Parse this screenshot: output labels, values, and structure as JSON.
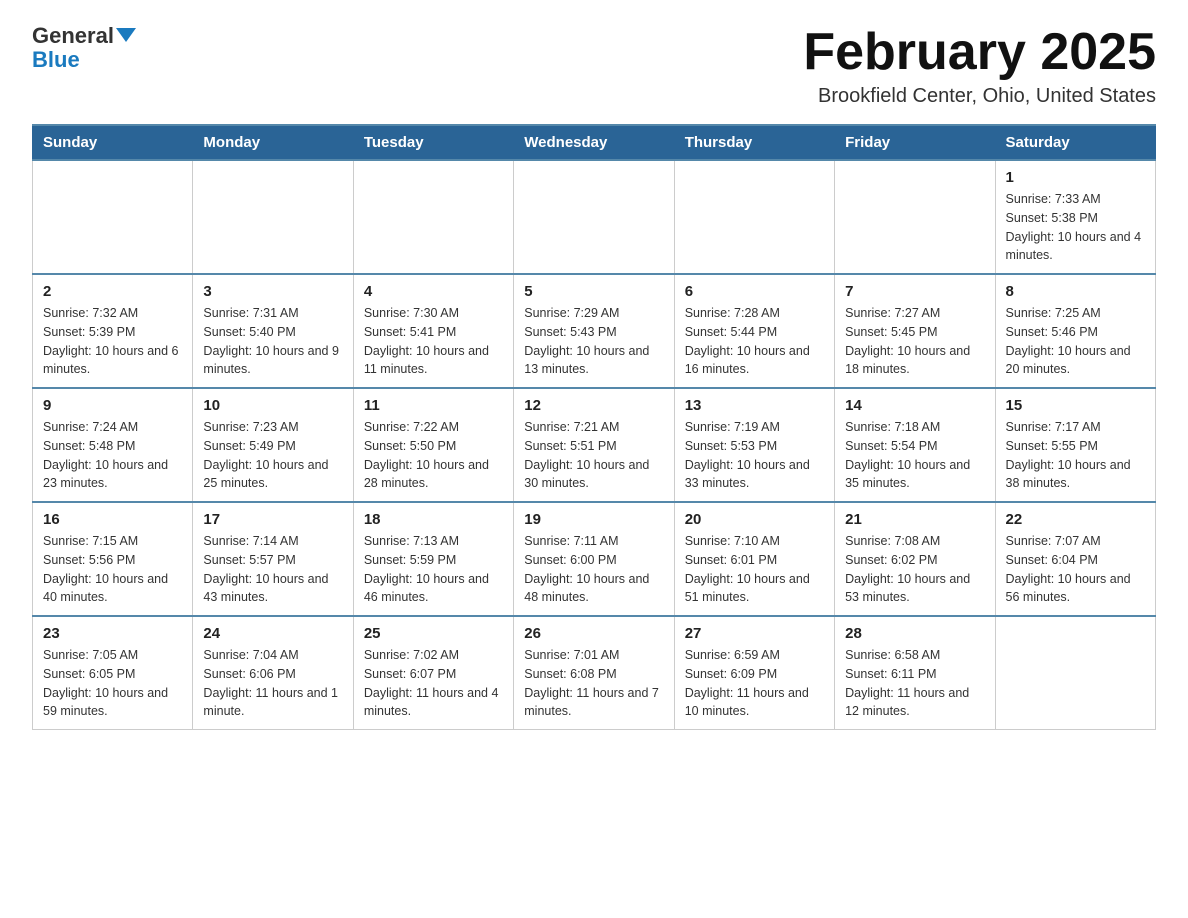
{
  "header": {
    "logo_line1": "General",
    "logo_line2": "Blue",
    "month_title": "February 2025",
    "location": "Brookfield Center, Ohio, United States"
  },
  "days_of_week": [
    "Sunday",
    "Monday",
    "Tuesday",
    "Wednesday",
    "Thursday",
    "Friday",
    "Saturday"
  ],
  "weeks": [
    [
      {
        "day": "",
        "info": ""
      },
      {
        "day": "",
        "info": ""
      },
      {
        "day": "",
        "info": ""
      },
      {
        "day": "",
        "info": ""
      },
      {
        "day": "",
        "info": ""
      },
      {
        "day": "",
        "info": ""
      },
      {
        "day": "1",
        "info": "Sunrise: 7:33 AM\nSunset: 5:38 PM\nDaylight: 10 hours and 4 minutes."
      }
    ],
    [
      {
        "day": "2",
        "info": "Sunrise: 7:32 AM\nSunset: 5:39 PM\nDaylight: 10 hours and 6 minutes."
      },
      {
        "day": "3",
        "info": "Sunrise: 7:31 AM\nSunset: 5:40 PM\nDaylight: 10 hours and 9 minutes."
      },
      {
        "day": "4",
        "info": "Sunrise: 7:30 AM\nSunset: 5:41 PM\nDaylight: 10 hours and 11 minutes."
      },
      {
        "day": "5",
        "info": "Sunrise: 7:29 AM\nSunset: 5:43 PM\nDaylight: 10 hours and 13 minutes."
      },
      {
        "day": "6",
        "info": "Sunrise: 7:28 AM\nSunset: 5:44 PM\nDaylight: 10 hours and 16 minutes."
      },
      {
        "day": "7",
        "info": "Sunrise: 7:27 AM\nSunset: 5:45 PM\nDaylight: 10 hours and 18 minutes."
      },
      {
        "day": "8",
        "info": "Sunrise: 7:25 AM\nSunset: 5:46 PM\nDaylight: 10 hours and 20 minutes."
      }
    ],
    [
      {
        "day": "9",
        "info": "Sunrise: 7:24 AM\nSunset: 5:48 PM\nDaylight: 10 hours and 23 minutes."
      },
      {
        "day": "10",
        "info": "Sunrise: 7:23 AM\nSunset: 5:49 PM\nDaylight: 10 hours and 25 minutes."
      },
      {
        "day": "11",
        "info": "Sunrise: 7:22 AM\nSunset: 5:50 PM\nDaylight: 10 hours and 28 minutes."
      },
      {
        "day": "12",
        "info": "Sunrise: 7:21 AM\nSunset: 5:51 PM\nDaylight: 10 hours and 30 minutes."
      },
      {
        "day": "13",
        "info": "Sunrise: 7:19 AM\nSunset: 5:53 PM\nDaylight: 10 hours and 33 minutes."
      },
      {
        "day": "14",
        "info": "Sunrise: 7:18 AM\nSunset: 5:54 PM\nDaylight: 10 hours and 35 minutes."
      },
      {
        "day": "15",
        "info": "Sunrise: 7:17 AM\nSunset: 5:55 PM\nDaylight: 10 hours and 38 minutes."
      }
    ],
    [
      {
        "day": "16",
        "info": "Sunrise: 7:15 AM\nSunset: 5:56 PM\nDaylight: 10 hours and 40 minutes."
      },
      {
        "day": "17",
        "info": "Sunrise: 7:14 AM\nSunset: 5:57 PM\nDaylight: 10 hours and 43 minutes."
      },
      {
        "day": "18",
        "info": "Sunrise: 7:13 AM\nSunset: 5:59 PM\nDaylight: 10 hours and 46 minutes."
      },
      {
        "day": "19",
        "info": "Sunrise: 7:11 AM\nSunset: 6:00 PM\nDaylight: 10 hours and 48 minutes."
      },
      {
        "day": "20",
        "info": "Sunrise: 7:10 AM\nSunset: 6:01 PM\nDaylight: 10 hours and 51 minutes."
      },
      {
        "day": "21",
        "info": "Sunrise: 7:08 AM\nSunset: 6:02 PM\nDaylight: 10 hours and 53 minutes."
      },
      {
        "day": "22",
        "info": "Sunrise: 7:07 AM\nSunset: 6:04 PM\nDaylight: 10 hours and 56 minutes."
      }
    ],
    [
      {
        "day": "23",
        "info": "Sunrise: 7:05 AM\nSunset: 6:05 PM\nDaylight: 10 hours and 59 minutes."
      },
      {
        "day": "24",
        "info": "Sunrise: 7:04 AM\nSunset: 6:06 PM\nDaylight: 11 hours and 1 minute."
      },
      {
        "day": "25",
        "info": "Sunrise: 7:02 AM\nSunset: 6:07 PM\nDaylight: 11 hours and 4 minutes."
      },
      {
        "day": "26",
        "info": "Sunrise: 7:01 AM\nSunset: 6:08 PM\nDaylight: 11 hours and 7 minutes."
      },
      {
        "day": "27",
        "info": "Sunrise: 6:59 AM\nSunset: 6:09 PM\nDaylight: 11 hours and 10 minutes."
      },
      {
        "day": "28",
        "info": "Sunrise: 6:58 AM\nSunset: 6:11 PM\nDaylight: 11 hours and 12 minutes."
      },
      {
        "day": "",
        "info": ""
      }
    ]
  ]
}
